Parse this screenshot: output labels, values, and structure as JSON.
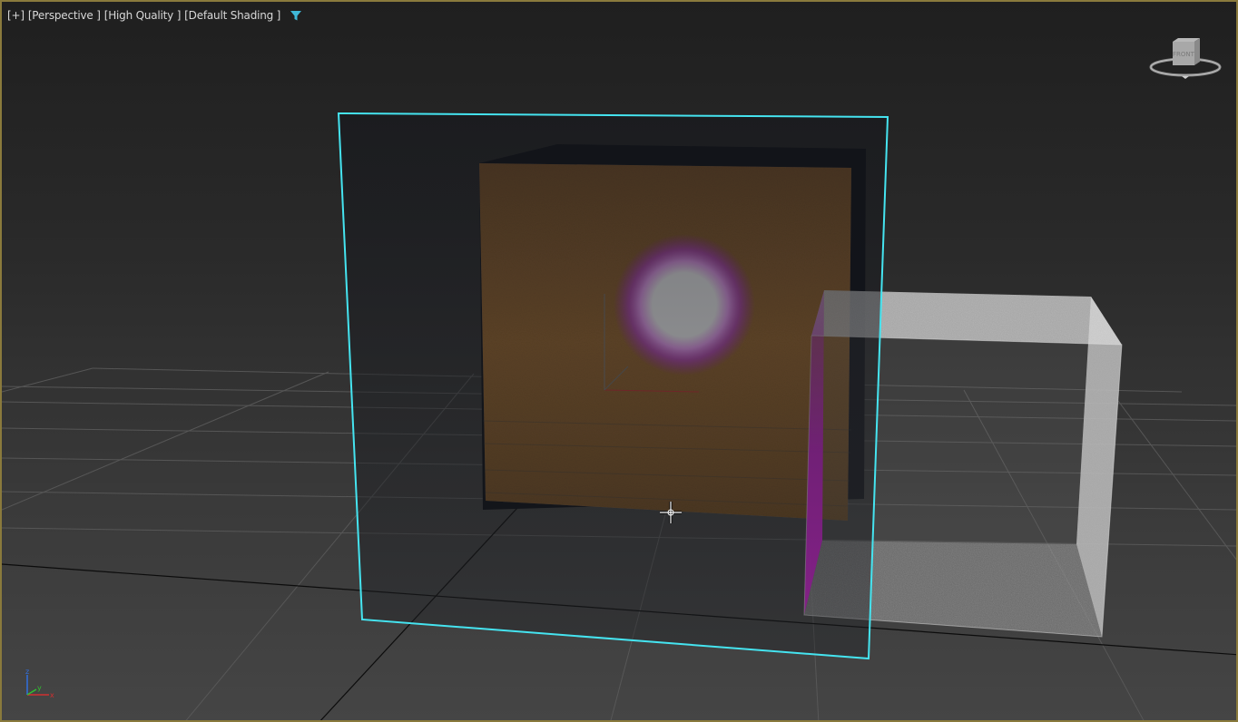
{
  "viewport": {
    "labels": {
      "plus": "[+]",
      "view": "[Perspective ]",
      "quality": "[High Quality ]",
      "shading": "[Default Shading ]"
    },
    "icons": {
      "filter": "filter-icon",
      "viewcube": "viewcube-icon",
      "axis": "axis-tripod-icon",
      "cursor": "move-cursor-icon"
    },
    "viewcube_face": "FRONT",
    "axis_labels": {
      "z": "z",
      "y": "y",
      "x": "x"
    }
  },
  "colors": {
    "border_active": "#8a7a3c",
    "selection": "#45e4f0",
    "glow": "#e060f0",
    "filter_icon": "#3fb8d8",
    "axis_x": "#d03030",
    "axis_y": "#30c030",
    "axis_z": "#3070e0"
  }
}
